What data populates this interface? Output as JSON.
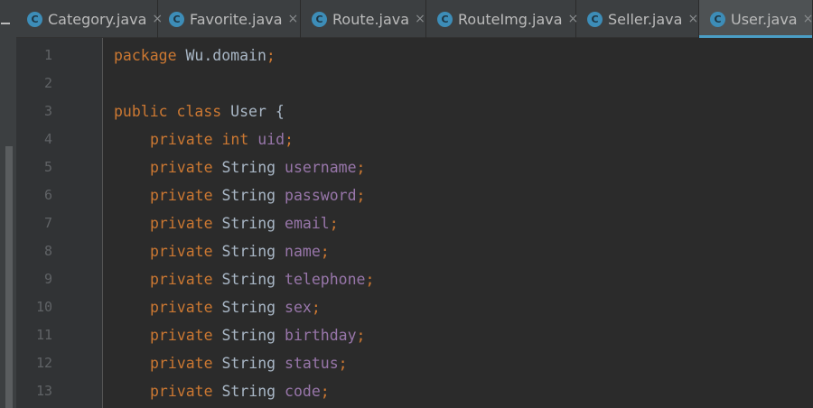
{
  "tabs": [
    {
      "icon": "class-icon",
      "icon_letter": "C",
      "label": "Category.java",
      "active": false
    },
    {
      "icon": "class-icon",
      "icon_letter": "C",
      "label": "Favorite.java",
      "active": false
    },
    {
      "icon": "class-icon",
      "icon_letter": "C",
      "label": "Route.java",
      "active": false
    },
    {
      "icon": "class-icon",
      "icon_letter": "C",
      "label": "RouteImg.java",
      "active": false
    },
    {
      "icon": "class-icon",
      "icon_letter": "C",
      "label": "Seller.java",
      "active": false
    },
    {
      "icon": "class-icon",
      "icon_letter": "C",
      "label": "User.java",
      "active": true
    }
  ],
  "close_glyph": "×",
  "line_numbers": [
    "1",
    "2",
    "3",
    "4",
    "5",
    "6",
    "7",
    "8",
    "9",
    "10",
    "11",
    "12",
    "13"
  ],
  "code": {
    "line1": {
      "keyword": "package",
      "text": " Wu.domain",
      "semicolon": ";"
    },
    "line3": {
      "kw1": "public",
      "kw2": "class",
      "name": " User ",
      "brace": "{"
    },
    "line4": {
      "kw1": "private",
      "kw2": "int",
      "field": "uid",
      "semicolon": ";"
    },
    "fields": [
      {
        "mod": "private",
        "type": "String",
        "name": "username",
        "semicolon": ";"
      },
      {
        "mod": "private",
        "type": "String",
        "name": "password",
        "semicolon": ";"
      },
      {
        "mod": "private",
        "type": "String",
        "name": "email",
        "semicolon": ";"
      },
      {
        "mod": "private",
        "type": "String",
        "name": "name",
        "semicolon": ";"
      },
      {
        "mod": "private",
        "type": "String",
        "name": "telephone",
        "semicolon": ";"
      },
      {
        "mod": "private",
        "type": "String",
        "name": "sex",
        "semicolon": ";"
      },
      {
        "mod": "private",
        "type": "String",
        "name": "birthday",
        "semicolon": ";"
      },
      {
        "mod": "private",
        "type": "String",
        "name": "status",
        "semicolon": ";"
      },
      {
        "mod": "private",
        "type": "String",
        "name": "code",
        "semicolon": ";"
      }
    ]
  },
  "colors": {
    "background": "#2b2b2b",
    "keyword": "#cc7832",
    "field": "#9876aa",
    "text": "#a9b7c6",
    "line_number": "#606366",
    "tab_accent": "#4a9ec6"
  }
}
